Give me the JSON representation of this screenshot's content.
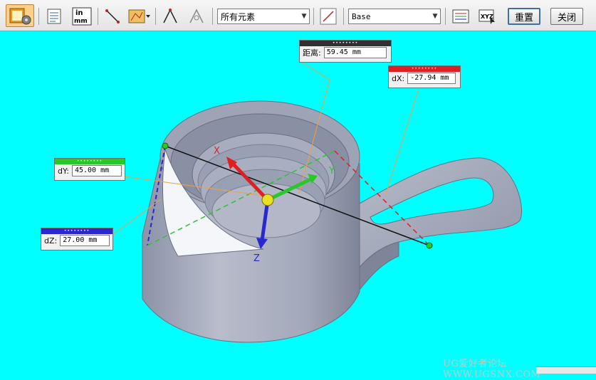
{
  "toolbar": {
    "filter_combo": {
      "value": "所有元素"
    },
    "style_combo": {
      "value": "Base"
    },
    "reset_label": "重置",
    "close_label": "关闭",
    "units_icon_text_top": "in",
    "units_icon_text_bottom": "mm",
    "xyz_icon_text": "XYZ"
  },
  "measurements": {
    "distance": {
      "label": "距离:",
      "value": "59.45 mm",
      "color": "#303030"
    },
    "dx": {
      "label": "dX:",
      "value": "-27.94 mm",
      "color": "#e02020"
    },
    "dy": {
      "label": "dY:",
      "value": "45.00 mm",
      "color": "#28c828"
    },
    "dz": {
      "label": "dZ:",
      "value": "27.00 mm",
      "color": "#2828d0"
    }
  },
  "triad": {
    "x_label": "X",
    "y_label": "Y",
    "z_label": "Z"
  },
  "watermark": "UG爱好者论坛 WWW.UGSNX.COM",
  "colors": {
    "background": "#00ffff",
    "part": "#a8aec0",
    "leader": "#f0a040"
  }
}
